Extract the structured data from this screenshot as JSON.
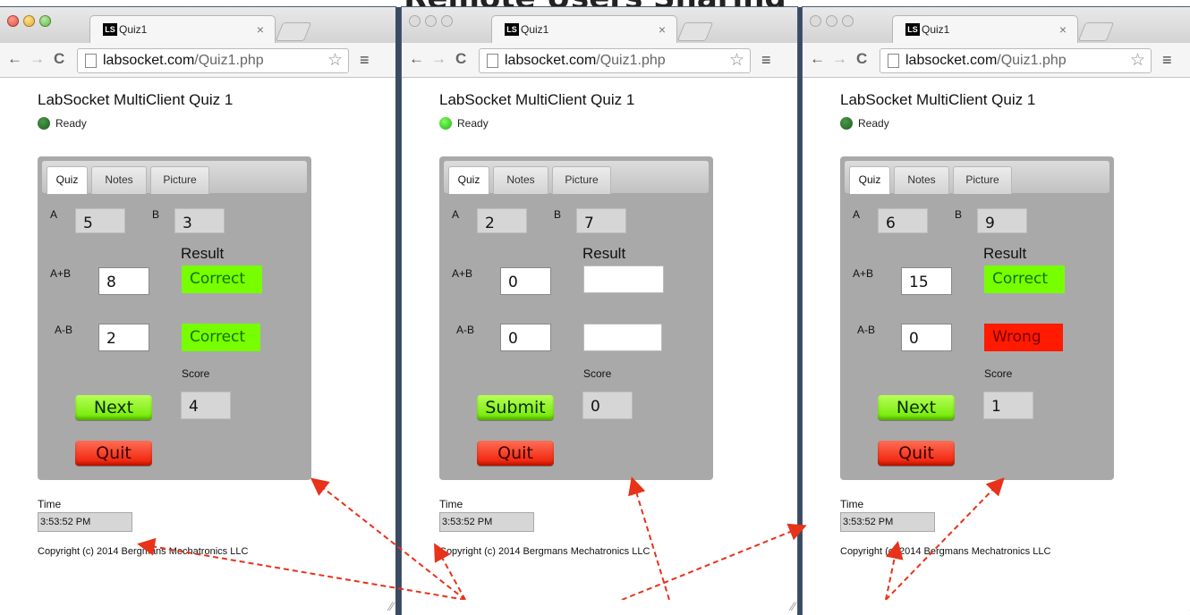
{
  "caption": "Remote Users Sharing",
  "windows": [
    {
      "active": true,
      "tab": {
        "favicon": "LS",
        "title": "Quiz1",
        "close": "×"
      },
      "url": {
        "host": "labsocket.com",
        "path": "/Quiz1.php"
      },
      "page": {
        "title": "LabSocket MultiClient Quiz 1",
        "status": "Ready",
        "status_led": "dark",
        "tabs": [
          "Quiz",
          "Notes",
          "Picture"
        ],
        "labels": {
          "a": "A",
          "b": "B",
          "result": "Result",
          "sum": "A+B",
          "diff": "A-B",
          "score": "Score"
        },
        "values": {
          "a": "5",
          "b": "3",
          "sum": "8",
          "diff": "2",
          "score": "4"
        },
        "results": [
          {
            "text": "Correct",
            "state": "correct"
          },
          {
            "text": "Correct",
            "state": "correct"
          }
        ],
        "primary_button": "Next",
        "quit_button": "Quit",
        "time_label": "Time",
        "time": "3:53:52 PM",
        "copyright": "Copyright (c) 2014 Bergmans Mechatronics LLC"
      }
    },
    {
      "active": false,
      "tab": {
        "favicon": "LS",
        "title": "Quiz1",
        "close": "×"
      },
      "url": {
        "host": "labsocket.com",
        "path": "/Quiz1.php"
      },
      "page": {
        "title": "LabSocket MultiClient Quiz 1",
        "status": "Ready",
        "status_led": "bright",
        "tabs": [
          "Quiz",
          "Notes",
          "Picture"
        ],
        "labels": {
          "a": "A",
          "b": "B",
          "result": "Result",
          "sum": "A+B",
          "diff": "A-B",
          "score": "Score"
        },
        "values": {
          "a": "2",
          "b": "7",
          "sum": "0",
          "diff": "0",
          "score": "0"
        },
        "results": [
          {
            "text": "",
            "state": "blank"
          },
          {
            "text": "",
            "state": "blank"
          }
        ],
        "primary_button": "Submit",
        "quit_button": "Quit",
        "time_label": "Time",
        "time": "3:53:52 PM",
        "copyright": "Copyright (c) 2014 Bergmans Mechatronics LLC"
      }
    },
    {
      "active": false,
      "tab": {
        "favicon": "LS",
        "title": "Quiz1",
        "close": "×"
      },
      "url": {
        "host": "labsocket.com",
        "path": "/Quiz1.php"
      },
      "page": {
        "title": "LabSocket MultiClient Quiz 1",
        "status": "Ready",
        "status_led": "dark",
        "tabs": [
          "Quiz",
          "Notes",
          "Picture"
        ],
        "labels": {
          "a": "A",
          "b": "B",
          "result": "Result",
          "sum": "A+B",
          "diff": "A-B",
          "score": "Score"
        },
        "values": {
          "a": "6",
          "b": "9",
          "sum": "15",
          "diff": "0",
          "score": "1"
        },
        "results": [
          {
            "text": "Correct",
            "state": "correct"
          },
          {
            "text": "Wrong",
            "state": "wrong"
          }
        ],
        "primary_button": "Next",
        "quit_button": "Quit",
        "time_label": "Time",
        "time": "3:53:52 PM",
        "copyright": "Copyright (c) 2014 Bergmans Mechatronics LLC"
      }
    }
  ],
  "icons": {
    "back": "←",
    "forward": "→",
    "reload": "C",
    "star": "☆",
    "menu": "≡",
    "grip": "⁄⁄"
  },
  "colors": {
    "correct": "#77ff00",
    "wrong": "#ff1a00",
    "panel": "#a9a9a9",
    "arrow": "#e8321a"
  }
}
